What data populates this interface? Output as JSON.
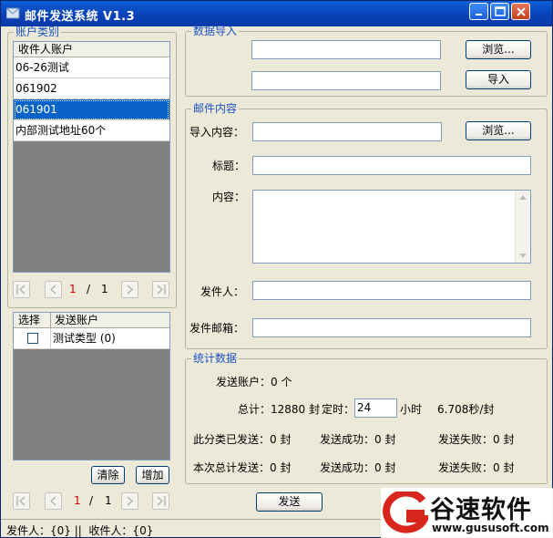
{
  "window": {
    "title": "邮件发送系统 V1.3"
  },
  "account_group": {
    "legend": "账户类别",
    "column": "收件人账户",
    "rows": [
      "06-26测试",
      "061902",
      "061901",
      "内部测试地址60个"
    ],
    "selected_index": 2,
    "page_current": "1",
    "page_sep": "/",
    "page_total": "1"
  },
  "sender_table": {
    "col_select": "选择",
    "col_account": "发送账户",
    "rows": [
      {
        "name": "测试类型 (0)",
        "checked": false
      }
    ],
    "clear_label": "清除",
    "add_label": "增加",
    "page_current": "1",
    "page_sep": "/",
    "page_total": "1"
  },
  "import_group": {
    "legend": "数据导入",
    "browse_label": "浏览...",
    "import_label": "导入",
    "field1_value": "",
    "field2_value": ""
  },
  "mail_group": {
    "legend": "邮件内容",
    "import_content_label": "导入内容：",
    "browse_label": "浏览...",
    "subject_label": "标题：",
    "content_label": "内容：",
    "sender_label": "发件人：",
    "sender_email_label": "发件邮箱："
  },
  "stats_group": {
    "legend": "统计数据",
    "send_accounts": "发送账户：0 个",
    "total": "总计：12880 封",
    "timer_label": "定时：",
    "timer_value": "24",
    "hours": "小时",
    "rate": "6.708秒/封",
    "cat_sent": "此分类已发送：0 封",
    "cat_success": "发送成功：0 封",
    "cat_fail": "发送失败：0 封",
    "total_sent": "本次总计发送：0 封",
    "total_success": "发送成功：0 封",
    "total_fail": "发送失败：0 封"
  },
  "send_button": "发送",
  "status_bar": "发件人：{0} ||  收件人：{0}",
  "watermark": {
    "brand": "谷速软件",
    "url": "www.gususoft.com"
  },
  "colors": {
    "title_bar": "#0a3fb4",
    "selection": "#0a64c8",
    "group_legend": "#1b52c4",
    "logo_red": "#d9261c"
  }
}
